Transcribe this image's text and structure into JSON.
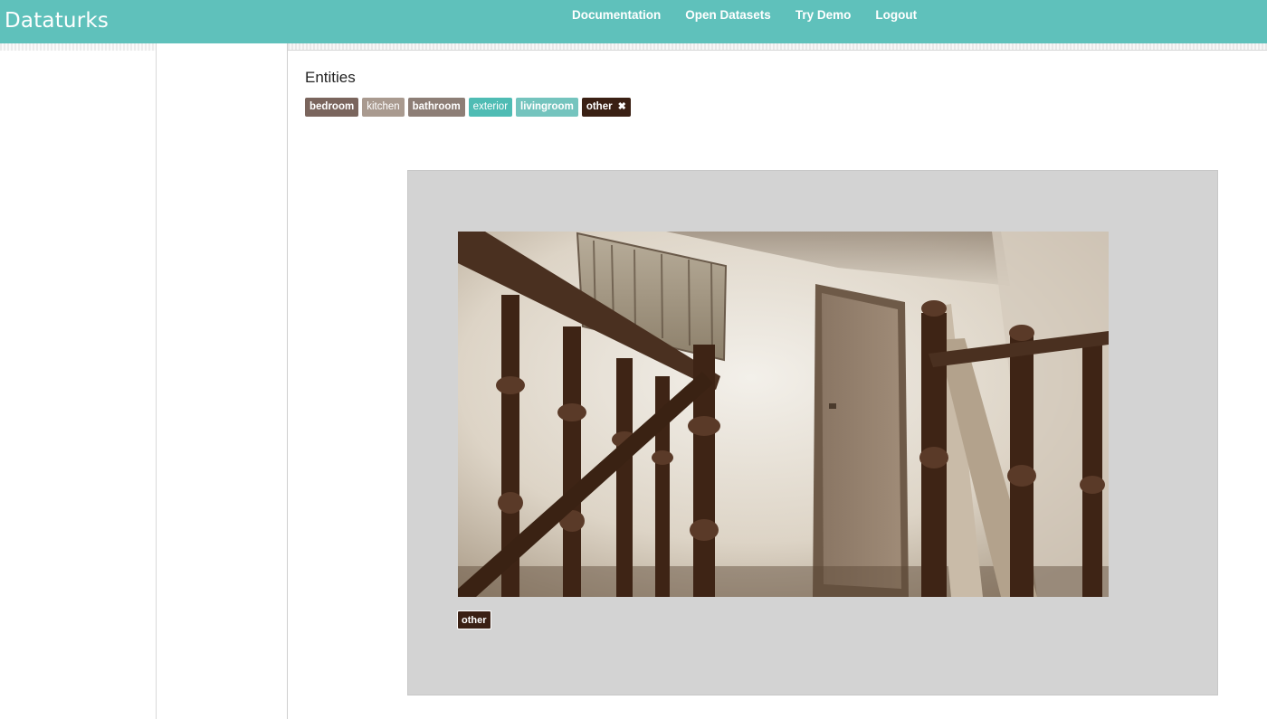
{
  "app": {
    "brand": "Dataturks"
  },
  "nav": {
    "items": [
      {
        "label": "Documentation"
      },
      {
        "label": "Open Datasets"
      },
      {
        "label": "Try Demo"
      },
      {
        "label": "Logout"
      }
    ]
  },
  "entities": {
    "title": "Entities",
    "tags": [
      {
        "label": "bedroom",
        "color": "#7a655d"
      },
      {
        "label": "kitchen",
        "color": "#a99a8f"
      },
      {
        "label": "bathroom",
        "color": "#8d7e76"
      },
      {
        "label": "exterior",
        "color": "#4fbcb4"
      },
      {
        "label": "livingroom",
        "color": "#74c4be"
      },
      {
        "label": "other",
        "color": "#3a2014",
        "selected": true,
        "remove_icon": "close-icon"
      }
    ]
  },
  "image_panel": {
    "image_subject": "staircase-photo",
    "assigned_label": "other"
  },
  "colors": {
    "header": "#5fc1bb",
    "panel_bg": "#d3d3d3"
  }
}
